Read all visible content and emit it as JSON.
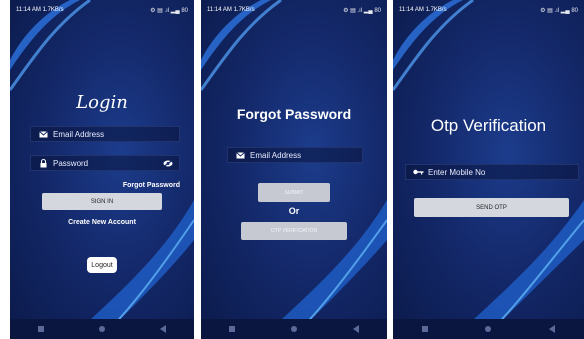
{
  "screens": {
    "login": {
      "status_time": "11:14 AM 1.7KB/s",
      "status_icons": "⚙ ▤ .ıl ▂▄ 80",
      "title": "Login",
      "email_placeholder": "Email Address",
      "password_placeholder": "Password",
      "forgot_label": "Forgot Password",
      "signin_label": "SIGN IN",
      "create_label": "Create New Account",
      "logout_label": "Logout"
    },
    "forgot": {
      "status_time": "11:14 AM 1.7KB/s",
      "status_icons": "⚙ ▤ .ıl ▂▄ 80",
      "title": "Forgot Password",
      "email_placeholder": "Email Address",
      "submit_label": "SUBMIT",
      "or_label": "Or",
      "otp_label": "OTP VERIFICATION"
    },
    "otp": {
      "status_time": "11:14 AM 1.7KB/s",
      "status_icons": "⚙ ▤ .ıl ▂▄ 80",
      "title": "Otp Verification",
      "mobile_placeholder": "Enter Mobile No",
      "send_label": "SEND OTP"
    }
  },
  "colors": {
    "background": "#14296b",
    "accent": "#1f8fe0",
    "button": "#d5d7df"
  }
}
